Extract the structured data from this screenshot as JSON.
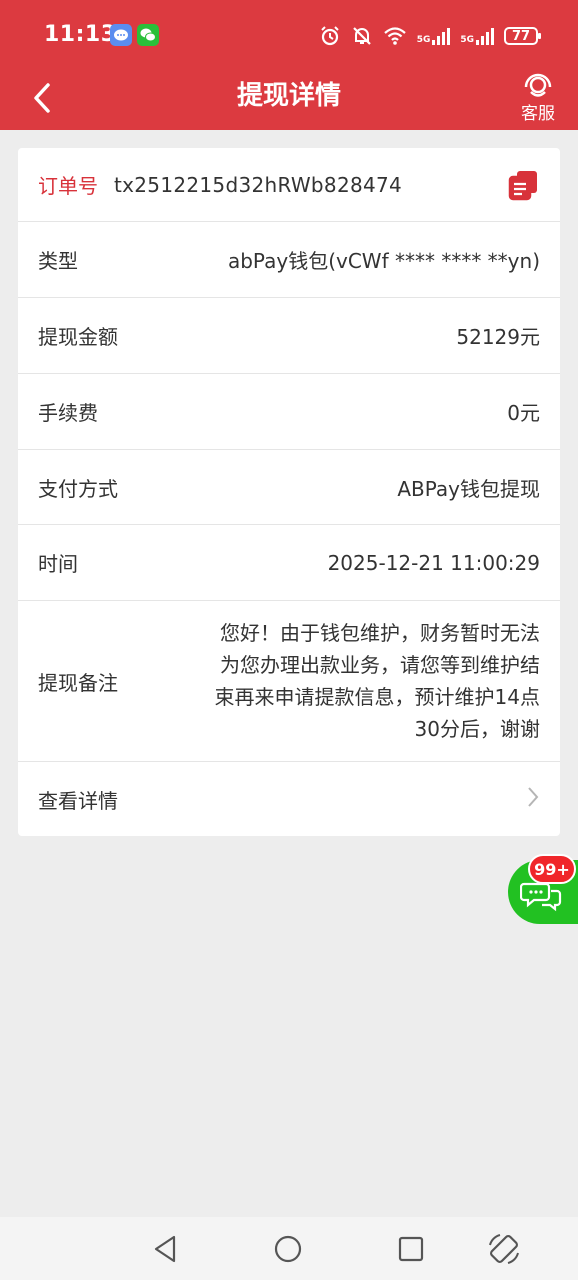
{
  "status_bar": {
    "time": "11:13",
    "battery": "77",
    "network_1": "5G",
    "network_2": "5G"
  },
  "header": {
    "back_icon": "chevron-left-icon",
    "title": "提现详情",
    "service_label": "客服",
    "service_icon": "headset-icon",
    "background_color": "#dc3a40"
  },
  "order": {
    "label": "订单号",
    "number": "tx2512215d32hRWb828474",
    "copy_icon": "copy-icon"
  },
  "details": [
    {
      "label": "类型",
      "value": "abPay钱包(vCWf **** **** **yn)"
    },
    {
      "label": "提现金额",
      "value": "52129元"
    },
    {
      "label": "手续费",
      "value": "0元"
    },
    {
      "label": "支付方式",
      "value": "ABPay钱包提现"
    },
    {
      "label": "时间",
      "value": "2025-12-21 11:00:29"
    }
  ],
  "remark": {
    "label": "提现备注",
    "lines": [
      "您好！由于钱包维护，财务暂时无法",
      "为您办理出款业务，请您等到维护结",
      "束再来申请提款信息，预计维护14点",
      "30分后，谢谢"
    ]
  },
  "more": {
    "label": "查看详情",
    "icon": "chevron-right-icon"
  },
  "floating_chat": {
    "badge": "99+",
    "icon": "chat-bubbles-icon",
    "color": "#22c122"
  },
  "nav_bar": {
    "back": "triangle-back-icon",
    "home": "circle-home-icon",
    "recents": "square-recents-icon",
    "rotate": "rotate-icon"
  }
}
